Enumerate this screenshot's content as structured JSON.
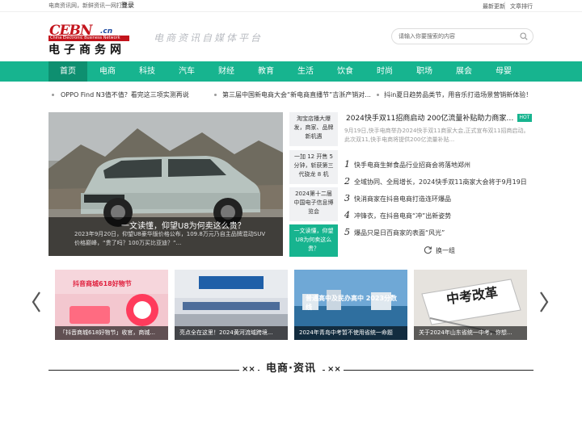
{
  "topbar": {
    "tagline": "电商资讯网，新鲜资讯一网打尽！",
    "login": "登录",
    "links": [
      "最新更新",
      "文章排行"
    ]
  },
  "logo": {
    "brand": "CEBN",
    "suffix": ".cn",
    "en": "China Electronic Business Network",
    "zh": "电子商务网"
  },
  "slogan": "电商资讯自媒体平台",
  "search": {
    "placeholder": "请输入你要搜索的内容",
    "icon": "search-icon"
  },
  "nav": [
    "首页",
    "电商",
    "科技",
    "汽车",
    "财经",
    "教育",
    "生活",
    "饮食",
    "时尚",
    "职场",
    "展会",
    "母婴"
  ],
  "ticker": [
    "OPPO Find N3值不值？看完这三项实测再说",
    "第三届中国新电商大会“新电商直播节”吉浙产销对...",
    "抖in夏日趋势品类节，用音乐打造场景营销新体验！"
  ],
  "hero": {
    "title": "一文读懂，仰望U8为何卖这么贵？",
    "desc": "2023年9月20日，仰望U8豪华版价格公布，109.8万元乃自主品牌混动SUV价格巅峰，“贵了吗？100万买比亚迪？”..."
  },
  "side_items": [
    "淘宝店播大爆发，商家、品牌新机遇",
    "一加 12 开售 5 分钟，斩获第三代骁龙 8 机",
    "2024第十二届中国电子信息博览会",
    "一文读懂，仰望U8为何卖这么贵？"
  ],
  "headline": {
    "title": "2024快手双11招商启动 200亿流量补贴助力商家全...",
    "badge": "HOT",
    "desc": "9月19日,快手电商举办2024快手双11商家大会,正式宣布双11招商启动。此次双11,快手电商将提供200亿流量补贴..."
  },
  "ranked": [
    {
      "rank": "1",
      "text": "快手电商生鲜食品行业招商会将落地郑州"
    },
    {
      "rank": "2",
      "text": "全域协同、全局增长，2024快手双11商家大会将于9月19日"
    },
    {
      "rank": "3",
      "text": "快消商家在抖音电商打造连环爆品"
    },
    {
      "rank": "4",
      "text": "冲锋衣，在抖音电商“冲”出新姿势"
    },
    {
      "rank": "5",
      "text": "爆品只是日百商家的表面“风光”"
    }
  ],
  "swap": "换一组",
  "cards": [
    {
      "caption": "「抖音商城618好物节」收官，商城...",
      "img_text": "抖音商城618好物节"
    },
    {
      "caption": "亮点全在这里！2024黄河流域跨境...",
      "img_text": ""
    },
    {
      "caption": "2024年青岛中考暂不使用省统一命题",
      "img_text": "普通高中及民办高中 2023分数线"
    },
    {
      "caption": "关于2024年山东省统一中考，你想...",
      "img_text": "中考改革"
    }
  ],
  "section": {
    "title": "电商·资讯",
    "deco": "××"
  },
  "colors": {
    "accent": "#17b48f",
    "accent_dark": "#0e8f70",
    "brand_red": "#c3141c",
    "brand_blue": "#1d4aa1"
  }
}
